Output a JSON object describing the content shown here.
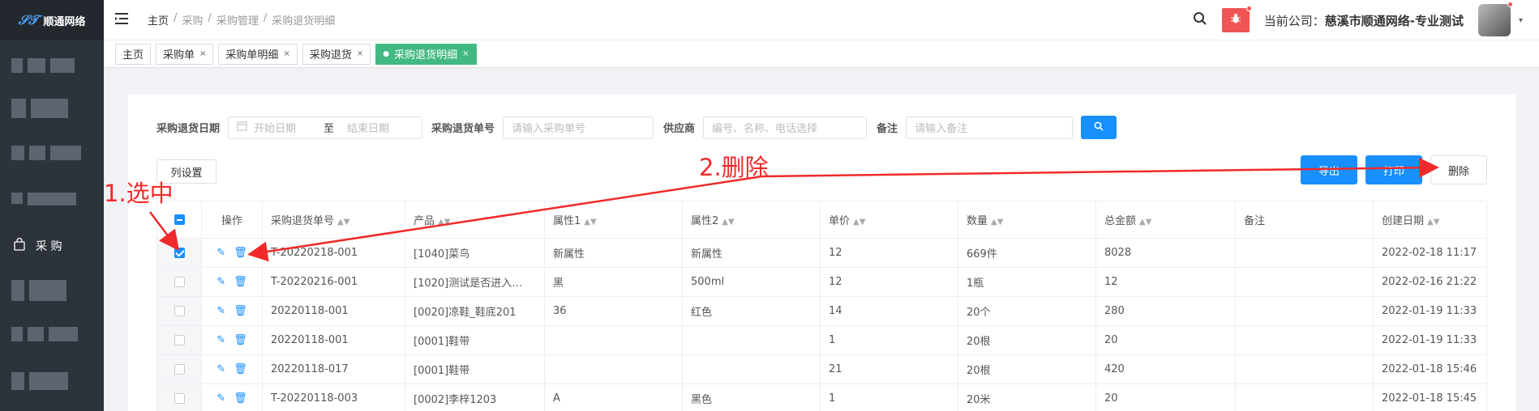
{
  "sidebar": {
    "logo_text": "顺通网络",
    "nav_purchase": "采 购"
  },
  "header": {
    "breadcrumb": [
      "主页",
      "采购",
      "采购管理",
      "采购退货明细"
    ],
    "company_label": "当前公司：",
    "company_name": "慈溪市顺通网络-专业测试"
  },
  "tabs": [
    {
      "label": "主页",
      "active": false,
      "closable": false
    },
    {
      "label": "采购单",
      "active": false,
      "closable": true
    },
    {
      "label": "采购单明细",
      "active": false,
      "closable": true
    },
    {
      "label": "采购退货",
      "active": false,
      "closable": true
    },
    {
      "label": "采购退货明细",
      "active": true,
      "closable": true
    }
  ],
  "filters": {
    "date_label": "采购退货日期",
    "start_placeholder": "开始日期",
    "to_label": "至",
    "end_placeholder": "结束日期",
    "number_label": "采购退货单号",
    "number_placeholder": "请输入采购单号",
    "supplier_label": "供应商",
    "supplier_placeholder": "编号、名称、电话选择",
    "remark_label": "备注",
    "remark_placeholder": "请输入备注"
  },
  "toolbar": {
    "column_settings": "列设置",
    "export": "导出",
    "print": "打印",
    "delete": "删除"
  },
  "table": {
    "headers": [
      "操作",
      "采购退货单号",
      "产品",
      "属性1",
      "属性2",
      "单价",
      "数量",
      "总金额",
      "备注",
      "创建日期"
    ],
    "rows": [
      {
        "checked": true,
        "cells": [
          "T-20220218-001",
          "[1040]菜鸟",
          "新属性",
          "新属性",
          "12",
          "669件",
          "8028",
          "",
          "2022-02-18 11:17"
        ]
      },
      {
        "checked": false,
        "cells": [
          "T-20220216-001",
          "[1020]测试是否进入…",
          "黑",
          "500ml",
          "12",
          "1瓶",
          "12",
          "",
          "2022-02-16 21:22"
        ]
      },
      {
        "checked": false,
        "cells": [
          "20220118-001",
          "[0020]凉鞋_鞋底201",
          "36",
          "红色",
          "14",
          "20个",
          "280",
          "",
          "2022-01-19 11:33"
        ]
      },
      {
        "checked": false,
        "cells": [
          "20220118-001",
          "[0001]鞋带",
          "",
          "",
          "1",
          "20根",
          "20",
          "",
          "2022-01-19 11:33"
        ]
      },
      {
        "checked": false,
        "cells": [
          "20220118-017",
          "[0001]鞋带",
          "",
          "",
          "21",
          "20根",
          "420",
          "",
          "2022-01-18 15:46"
        ]
      },
      {
        "checked": false,
        "cells": [
          "T-20220118-003",
          "[0002]李梓1203",
          "A",
          "黑色",
          "1",
          "20米",
          "20",
          "",
          "2022-01-18 15:45"
        ]
      }
    ]
  },
  "annotations": {
    "select_note": "1.选中",
    "delete_note": "2.删除"
  },
  "colors": {
    "primary": "#1890ff",
    "active_tab": "#42b983",
    "annotation": "#f02a2a",
    "sidebar": "#2d333b"
  }
}
